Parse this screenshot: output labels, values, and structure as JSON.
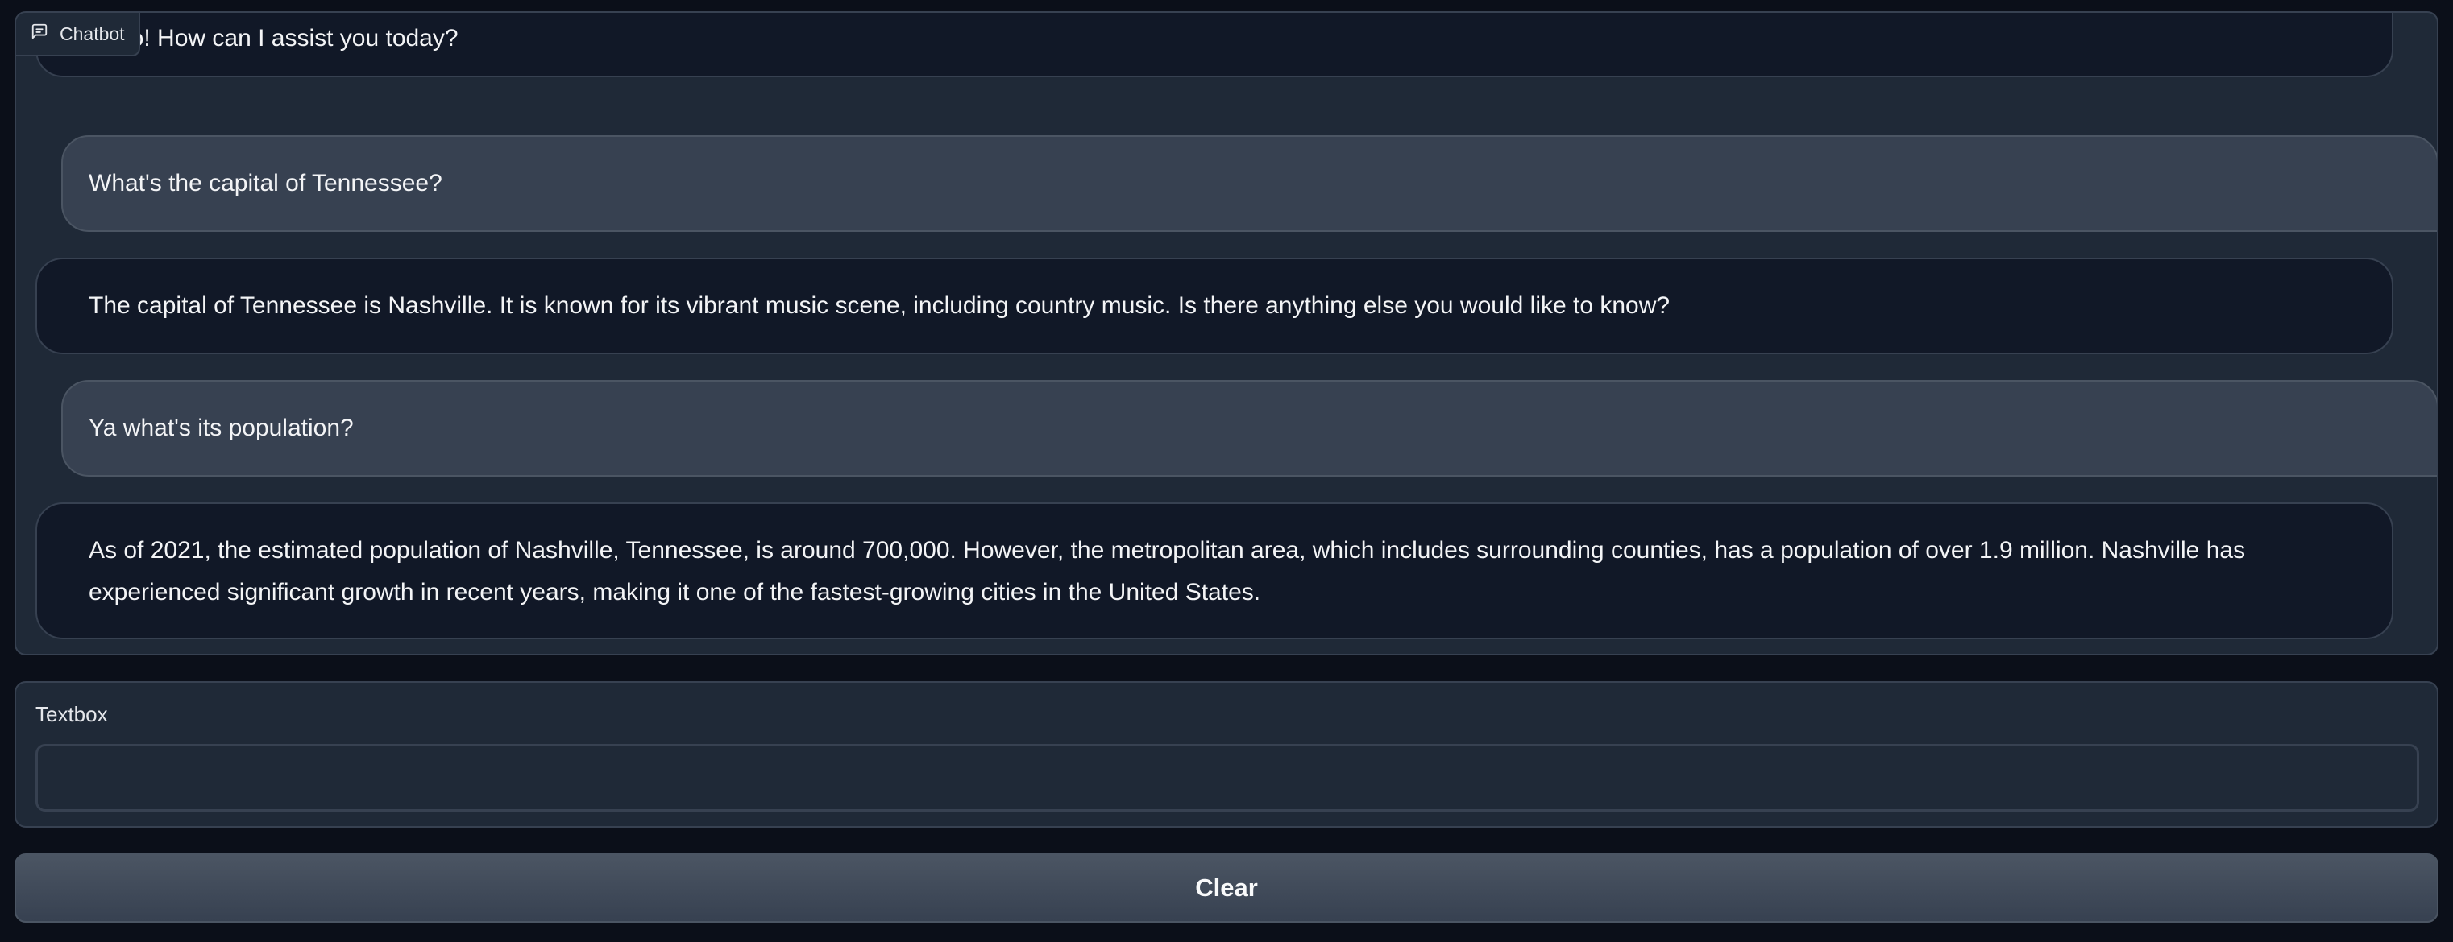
{
  "chatbot": {
    "label": "Chatbot",
    "label_icon": "chat-bubble-icon",
    "messages": [
      {
        "role": "bot",
        "text": "Hello! How can I assist you today?"
      },
      {
        "role": "user",
        "text": "What's the capital of Tennessee?"
      },
      {
        "role": "bot",
        "text": "The capital of Tennessee is Nashville. It is known for its vibrant music scene, including country music. Is there anything else you would like to know?"
      },
      {
        "role": "user",
        "text": "Ya what's its population?"
      },
      {
        "role": "bot",
        "text": "As of 2021, the estimated population of Nashville, Tennessee, is around 700,000. However, the metropolitan area, which includes surrounding counties, has a population of over 1.9 million. Nashville has experienced significant growth in recent years, making it one of the fastest-growing cities in the United States."
      }
    ]
  },
  "textbox": {
    "label": "Textbox",
    "value": "",
    "placeholder": ""
  },
  "clear_button": {
    "label": "Clear"
  },
  "colors": {
    "page_background": "#0b0f19",
    "panel_background": "#1f2937",
    "bot_bubble": "#111827",
    "user_bubble": "#374151",
    "border": "#374151",
    "button": "#4b5563"
  }
}
